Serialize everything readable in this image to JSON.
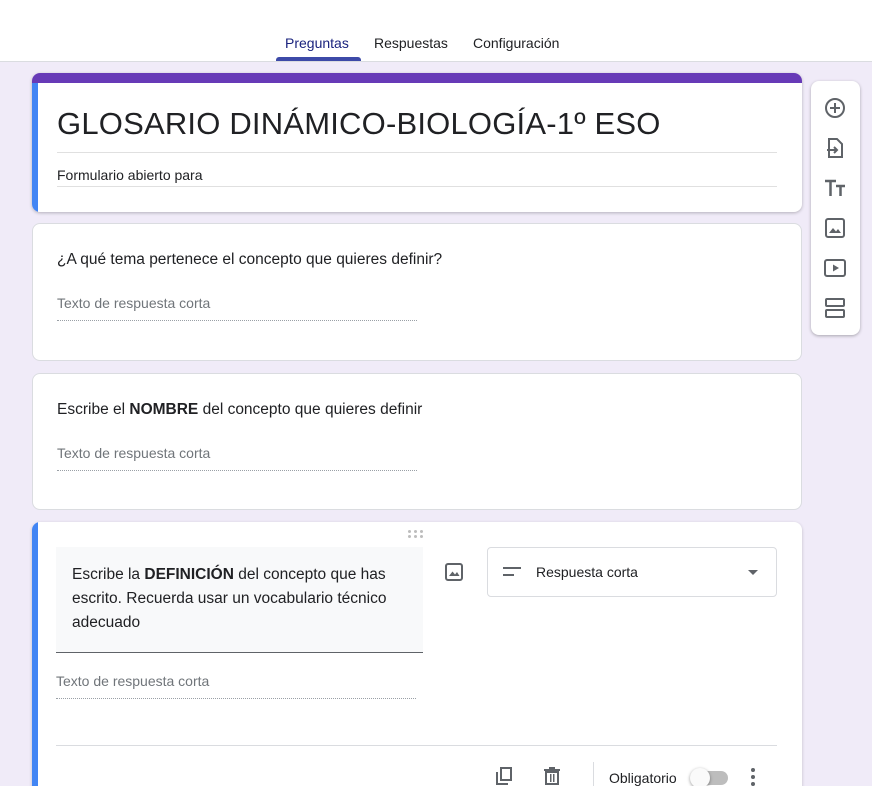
{
  "tabs": [
    {
      "label": "Preguntas",
      "active": true
    },
    {
      "label": "Respuestas",
      "active": false
    },
    {
      "label": "Configuración",
      "active": false
    }
  ],
  "form": {
    "title": "GLOSARIO DINÁMICO-BIOLOGÍA-1º ESO",
    "description": "Formulario abierto para"
  },
  "questions": [
    {
      "text": "¿A qué tema pertenece el concepto que quieres definir?",
      "answer_placeholder": "Texto de respuesta corta"
    },
    {
      "text_before": "Escribe el ",
      "text_bold": "NOMBRE",
      "text_after": " del concepto que quieres definir",
      "answer_placeholder": "Texto de respuesta corta"
    },
    {
      "text_before": "Escribe la ",
      "text_bold": "DEFINICIÓN",
      "text_after": " del concepto que has escrito. Recuerda usar un vocabulario técnico adecuado",
      "answer_placeholder": "Texto de respuesta corta",
      "type_label": "Respuesta corta",
      "required_label": "Obligatorio",
      "required": false
    }
  ],
  "toolbar": {
    "icons": [
      "add-question-icon",
      "import-questions-icon",
      "add-title-icon",
      "add-image-icon",
      "add-video-icon",
      "add-section-icon"
    ]
  },
  "colors": {
    "theme": "#673ab7",
    "accent": "#4285f4",
    "background": "#f0ebf8",
    "tab_active": "#3d4aa8"
  }
}
